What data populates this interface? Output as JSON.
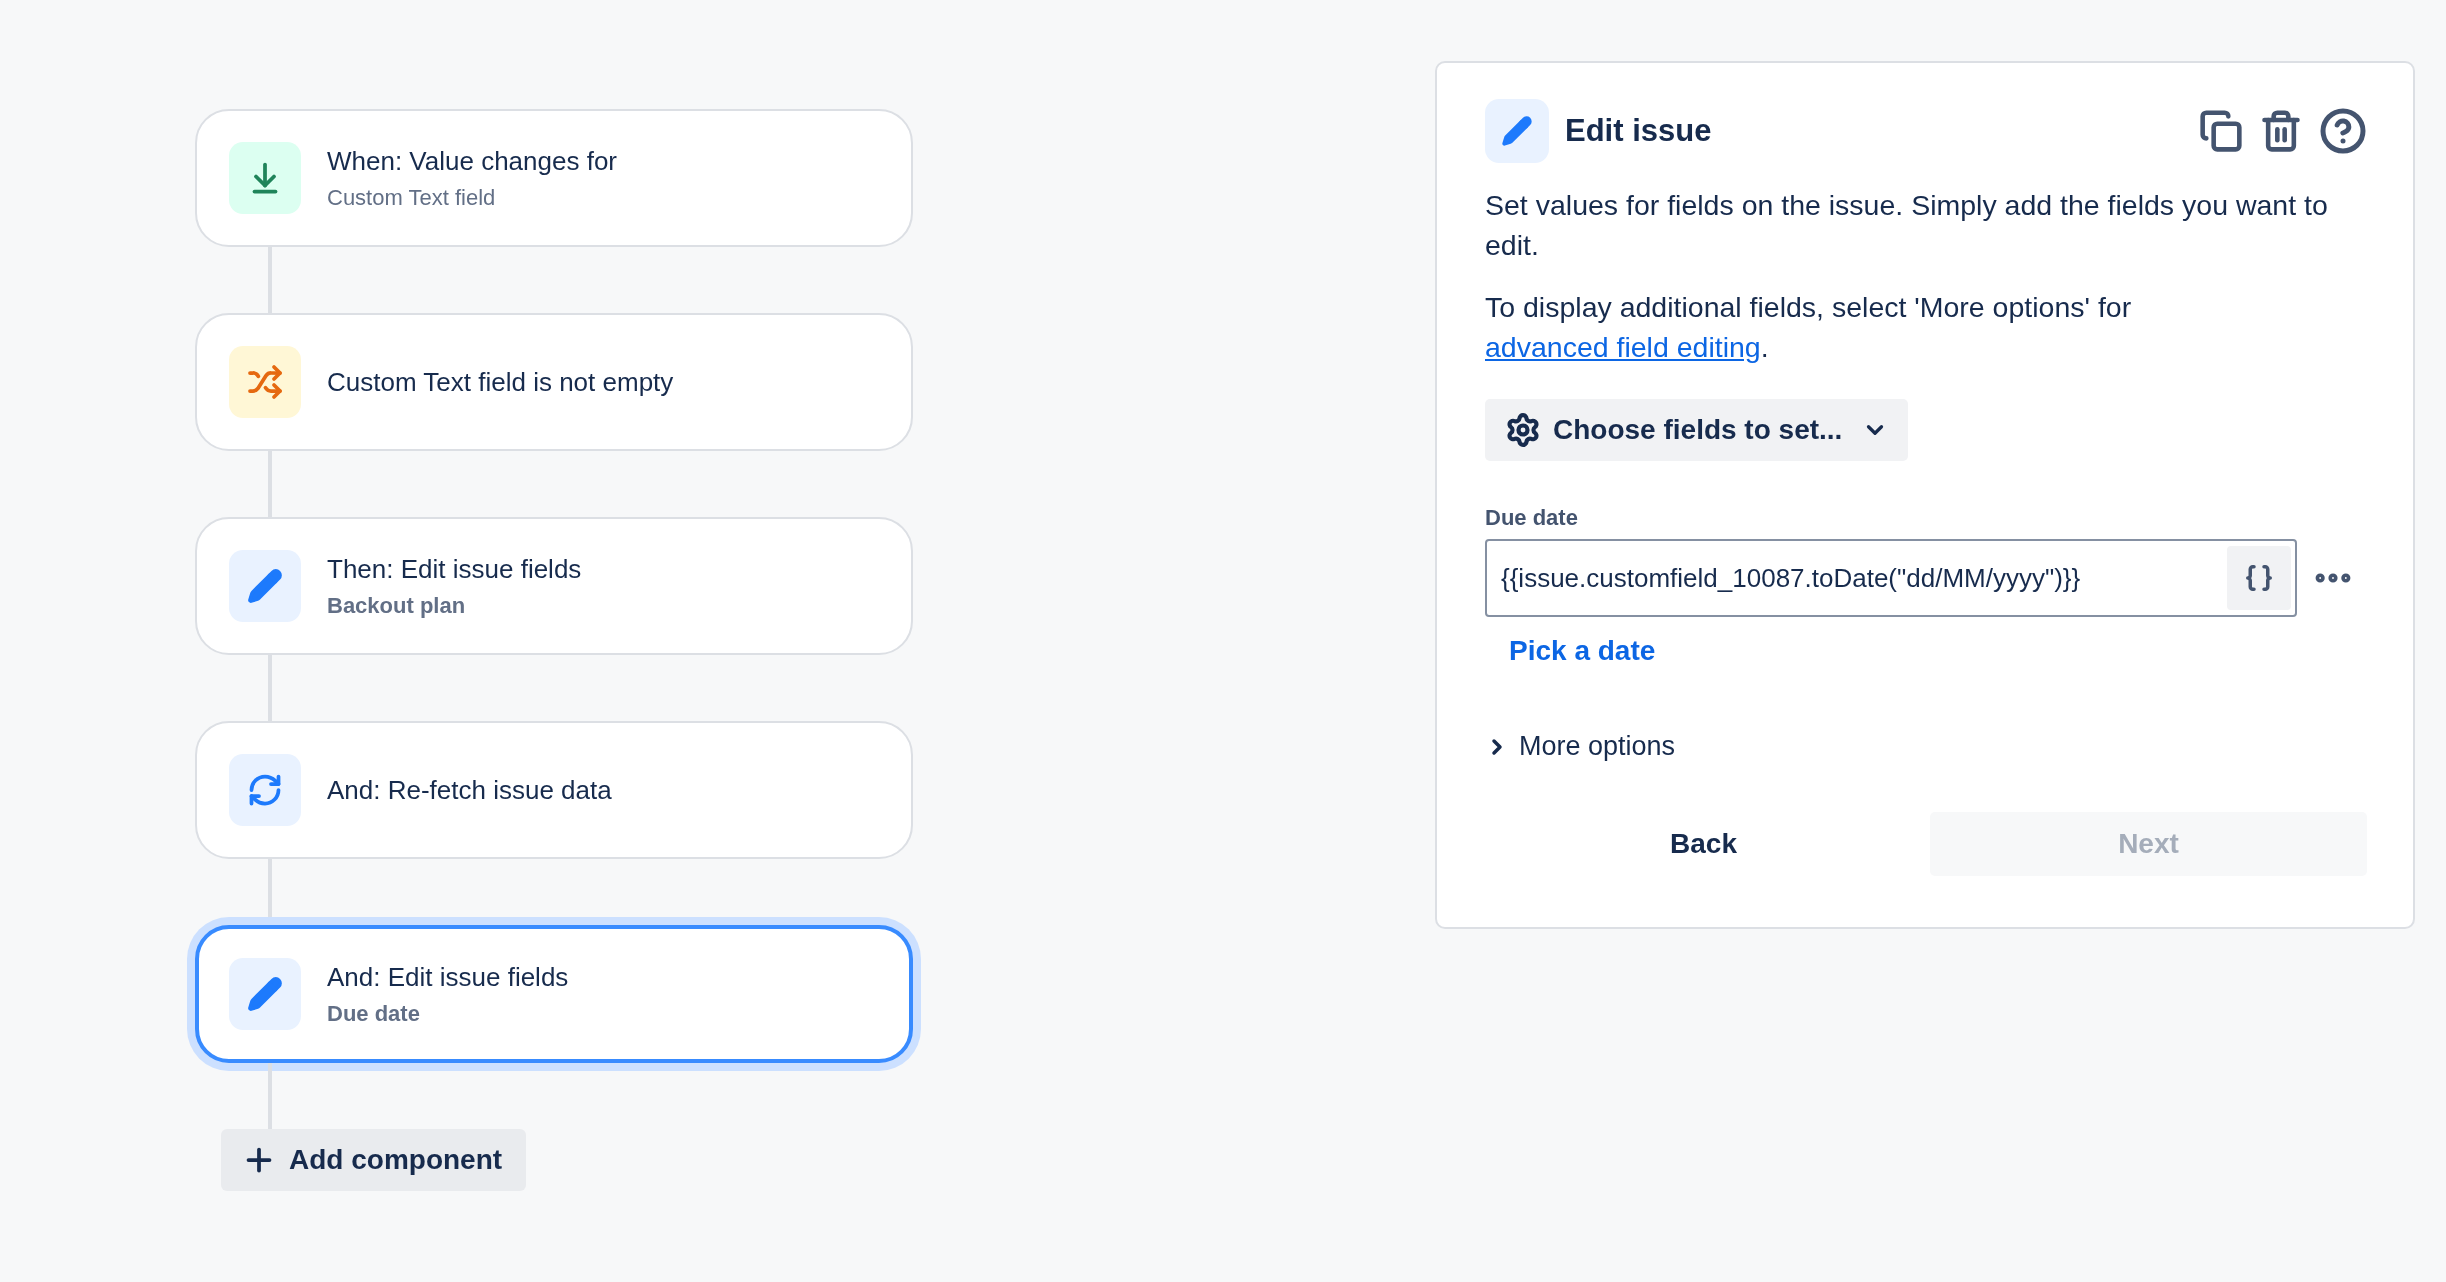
{
  "flow": {
    "steps": [
      {
        "kind": "trigger",
        "title": "When: Value changes for",
        "subtitle": "Custom Text field",
        "selected": false
      },
      {
        "kind": "condition",
        "title": "Custom Text field is not empty",
        "selected": false
      },
      {
        "kind": "action",
        "title": "Then: Edit issue fields",
        "subtitle": "Backout plan",
        "selected": false
      },
      {
        "kind": "refetch",
        "title": "And: Re-fetch issue data",
        "selected": false
      },
      {
        "kind": "action",
        "title": "And: Edit issue fields",
        "subtitle": "Due date",
        "selected": true
      }
    ],
    "add_button": "Add component"
  },
  "panel": {
    "title": "Edit issue",
    "description": "Set values for fields on the issue. Simply add the fields you want to edit.",
    "note_before": "To display additional fields, select 'More options' for ",
    "note_link": "advanced field editing",
    "note_after": ".",
    "fields_button": "Choose fields to set...",
    "field": {
      "label": "Due date",
      "value": "{{issue.customfield_10087.toDate(\"dd/MM/yyyy\")}}"
    },
    "pick_date_link": "Pick a date",
    "more_options": {
      "label": "More options",
      "expanded": false
    },
    "buttons": [
      {
        "label": "Back",
        "disabled": false
      },
      {
        "label": "Next",
        "disabled": true
      }
    ]
  }
}
